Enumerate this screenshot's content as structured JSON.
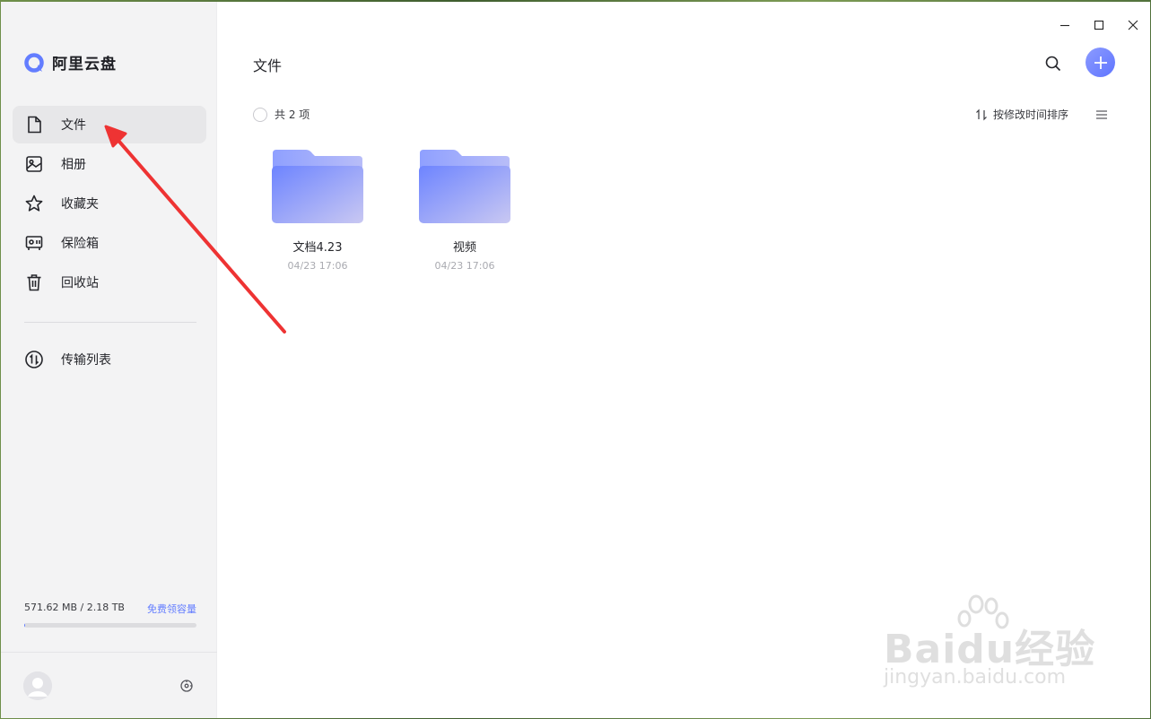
{
  "app": {
    "name": "阿里云盘"
  },
  "sidebar": {
    "items": [
      {
        "label": "文件",
        "icon": "file-icon",
        "active": true
      },
      {
        "label": "相册",
        "icon": "photo-album-icon",
        "active": false
      },
      {
        "label": "收藏夹",
        "icon": "star-icon",
        "active": false
      },
      {
        "label": "保险箱",
        "icon": "safe-icon",
        "active": false
      },
      {
        "label": "回收站",
        "icon": "trash-icon",
        "active": false
      }
    ],
    "transfer": {
      "label": "传输列表",
      "icon": "transfer-icon"
    },
    "storage": {
      "usage": "571.62 MB / 2.18 TB",
      "link": "免费领容量",
      "fill_fraction": 0.0003
    }
  },
  "main": {
    "title": "文件",
    "count_label": "共 2 项",
    "sort_label": "按修改时间排序",
    "files": [
      {
        "name": "文档4.23",
        "date": "04/23 17:06",
        "type": "folder"
      },
      {
        "name": "视频",
        "date": "04/23 17:06",
        "type": "folder"
      }
    ]
  },
  "colors": {
    "accent": "#637dff",
    "sidebar_bg": "#f3f3f4",
    "annotation_arrow": "#ee3333"
  },
  "watermark": {
    "brand": "Baidu经验",
    "url": "jingyan.baidu.com"
  }
}
